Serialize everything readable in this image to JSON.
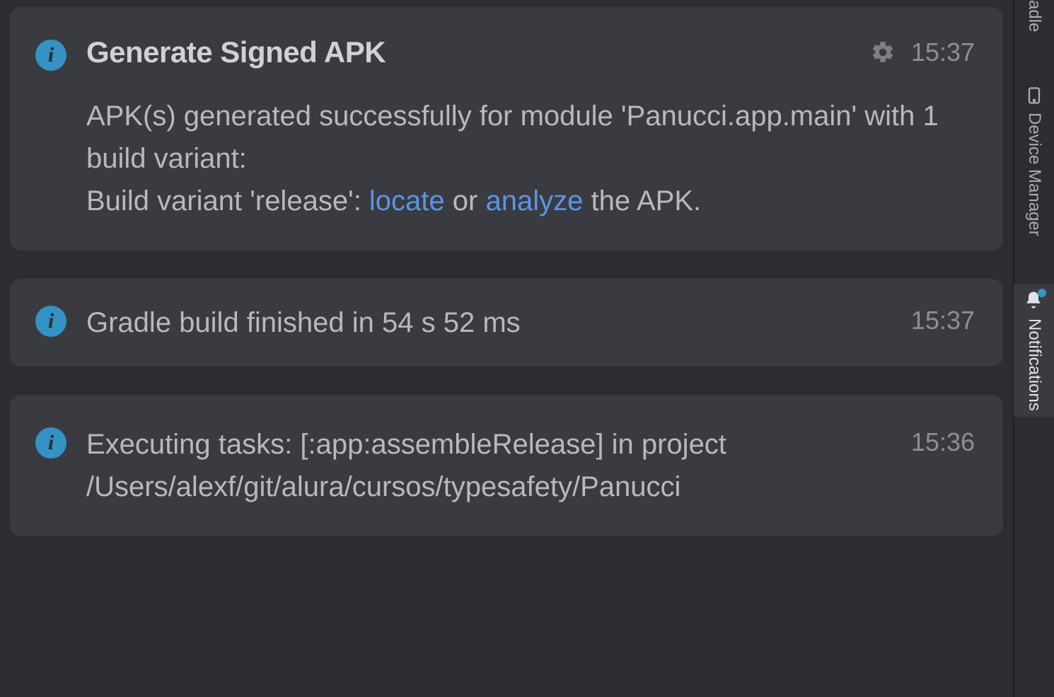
{
  "notifications": [
    {
      "title": "Generate Signed APK",
      "time": "15:37",
      "has_gear": true,
      "body_prefix": "APK(s) generated successfully for module 'Panucci.app.main' with 1 build variant:\nBuild variant 'release': ",
      "link1": "locate",
      "mid": " or ",
      "link2": "analyze",
      "body_suffix": " the APK."
    },
    {
      "title": "Gradle build finished in 54 s 52 ms",
      "time": "15:37"
    },
    {
      "title": "Executing tasks: [:app:assembleRelease] in project /Users/alexf/git/alura/cursos/typesafety/Panucci",
      "time": "15:36"
    }
  ],
  "sidebar": {
    "tabs": [
      {
        "label": "adle"
      },
      {
        "label": "Device Manager"
      },
      {
        "label": "Notifications",
        "active": true
      }
    ]
  }
}
